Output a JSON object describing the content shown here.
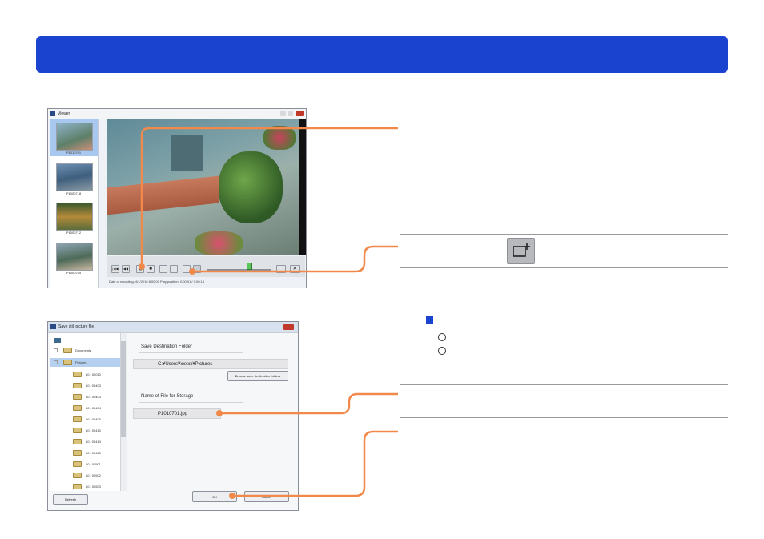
{
  "viewer": {
    "title": "Viewer",
    "thumbnails": [
      {
        "label": "P1010701"
      },
      {
        "label": "P1000718"
      },
      {
        "label": "P1000712"
      },
      {
        "label": "P1000765"
      }
    ],
    "status_text": "Date of recording: 4/1/2010 8:00:00    Play position: 0:00:01 / 0:00:14",
    "controls": [
      "|◀◀",
      "◀◀",
      "▮▮",
      "■",
      "",
      "",
      "",
      "",
      ""
    ]
  },
  "save_dialog": {
    "title": "Save still picture file",
    "tree": [
      {
        "label": "Documents"
      },
      {
        "label": "Pictures",
        "selected": true
      },
      {
        "label": "101 00010"
      },
      {
        "label": "101 00403"
      },
      {
        "label": "101 00403"
      },
      {
        "label": "101 00404"
      },
      {
        "label": "101 00405"
      },
      {
        "label": "101 00410"
      },
      {
        "label": "101 00414"
      },
      {
        "label": "101 00420"
      },
      {
        "label": "101 00501"
      },
      {
        "label": "101 00502"
      },
      {
        "label": "101 00503"
      }
    ],
    "refresh_label": "Refresh",
    "dest_heading": "Save Destination Folder",
    "dest_path": "C:¥Users¥xxxxx¥Pictures",
    "browse_label": "Browse save destination folders",
    "name_heading": "Name of File for Storage",
    "file_name": "P1010701.jpg",
    "ok_label": "OK",
    "cancel_label": "Cancel"
  },
  "colors": {
    "banner": "#1a43cf",
    "callout": "#f0894a"
  }
}
